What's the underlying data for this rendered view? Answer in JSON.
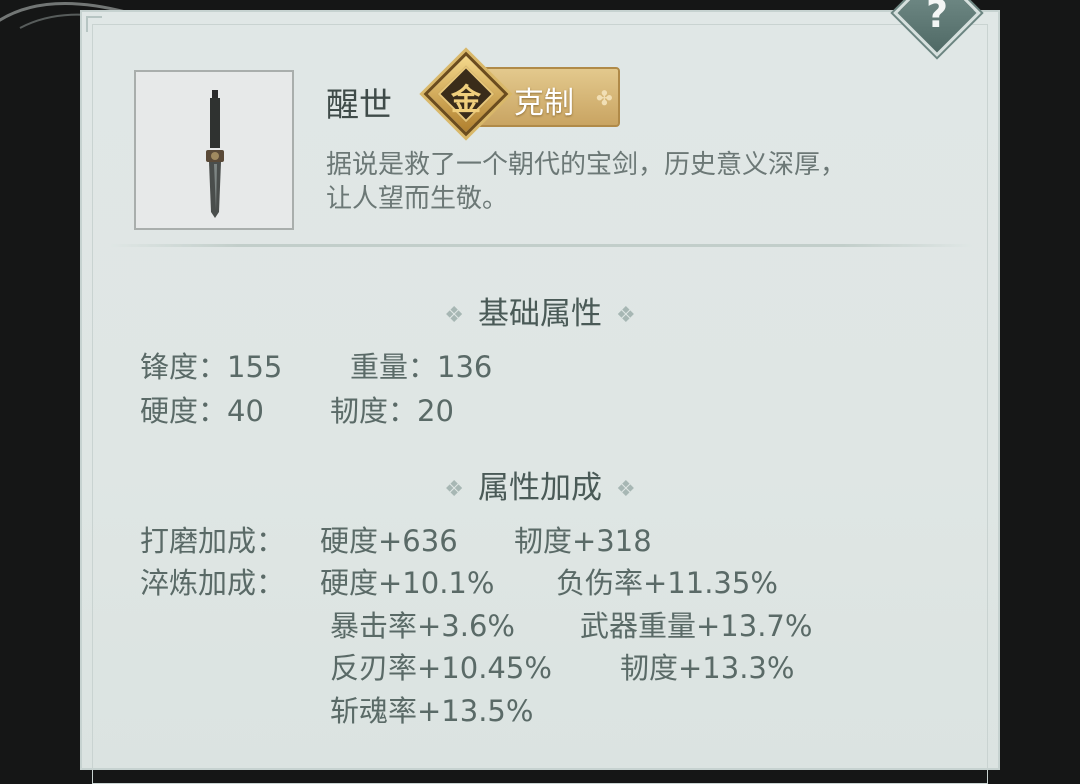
{
  "item": {
    "name": "醒世",
    "badge_glyph": "金",
    "badge_label": "克制",
    "description_line1": "据说是救了一个朝代的宝剑，历史意义深厚，",
    "description_line2": "让人望而生敬。"
  },
  "help": {
    "label": "?"
  },
  "base_attributes": {
    "title": "基础属性",
    "sharpness": "锋度：155",
    "weight": "重量：136",
    "hardness": "硬度：40",
    "toughness": "韧度：20"
  },
  "bonuses": {
    "title": "属性加成",
    "grind_label": "打磨加成：",
    "grind": [
      "硬度+636",
      "韧度+318"
    ],
    "temper_label": "淬炼加成：",
    "temper": [
      "硬度+10.1%",
      "负伤率+11.35%",
      "暴击率+3.6%",
      "武器重量+13.7%",
      "反刃率+10.45%",
      "韧度+13.3%",
      "斩魂率+13.5%"
    ]
  },
  "colors": {
    "panel_bg": "#e0e7e6",
    "badge_gold": "#c9a462",
    "text_dark": "#3f4b49",
    "text_stat": "#5a6a67"
  }
}
